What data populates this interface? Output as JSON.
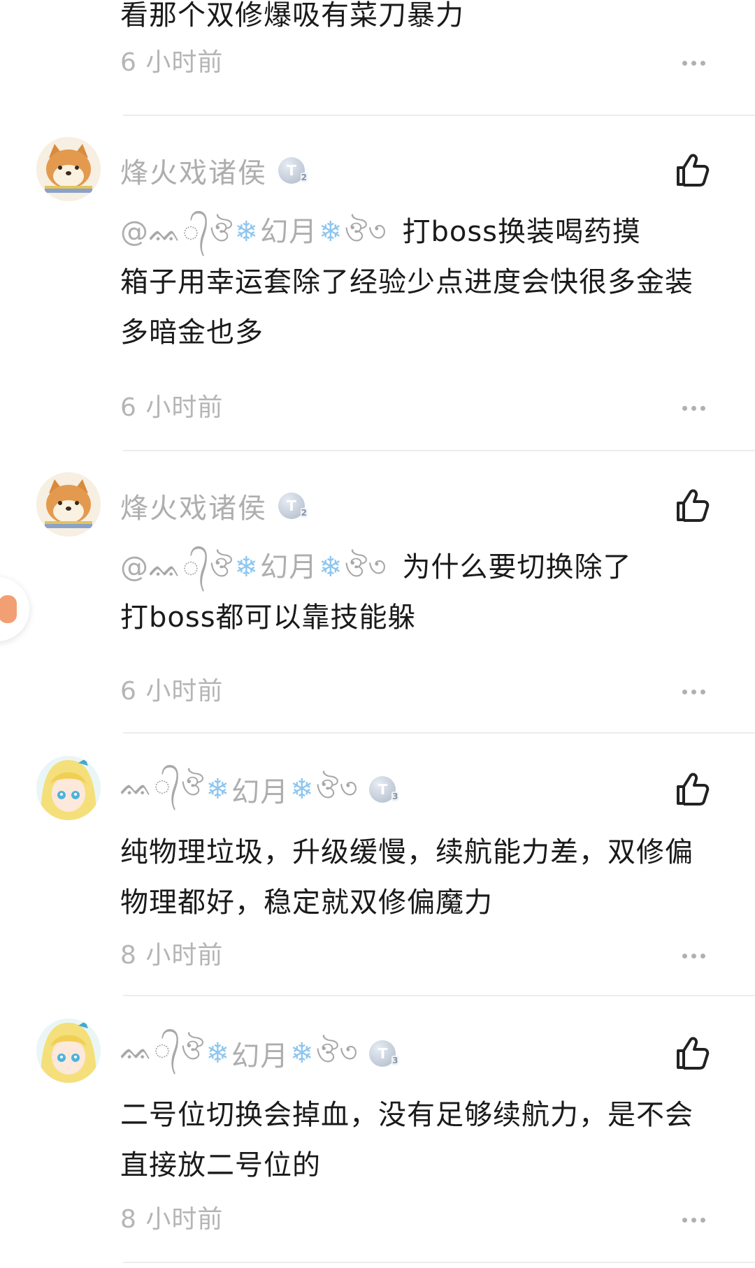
{
  "top_reply": {
    "text": "看那个双修爆吸有菜刀暴力",
    "time": "6 小时前"
  },
  "replies": [
    {
      "avatar": "shiba-dog-avatar",
      "name": "烽火戏诸侯",
      "badge": "T",
      "badge_level": "2",
      "mention_prefix": "@",
      "mention_swirl_left": "ᨐ᭄ঔ",
      "mention_core": "幻月",
      "mention_swirl_right": "ঔ৩",
      "text_first": "打boss换装喝药摸",
      "text_rest": "箱子用幸运套除了经验少点进度会快很多金装多暗金也多",
      "time": "6 小时前"
    },
    {
      "avatar": "shiba-dog-avatar",
      "name": "烽火戏诸侯",
      "badge": "T",
      "badge_level": "2",
      "mention_prefix": "@",
      "mention_swirl_left": "ᨐ᭄ঔ",
      "mention_core": "幻月",
      "mention_swirl_right": "ঔ৩",
      "text_first": "为什么要切换除了",
      "text_rest": "打boss都可以靠技能躲",
      "time": "6 小时前"
    },
    {
      "avatar": "anime-girl-avatar",
      "name_swirl_left": "ᨐ᭄ঔ",
      "name_core": "幻月",
      "name_swirl_right": "ঔ৩",
      "badge": "T",
      "badge_level": "3",
      "text": "纯物理垃圾，升级缓慢，续航能力差，双修偏物理都好，稳定就双修偏魔力",
      "time": "8 小时前"
    },
    {
      "avatar": "anime-girl-avatar",
      "name_swirl_left": "ᨐ᭄ঔ",
      "name_core": "幻月",
      "name_swirl_right": "ঔ৩",
      "badge": "T",
      "badge_level": "3",
      "text": "二号位切换会掉血，没有足够续航力，是不会直接放二号位的",
      "time": "8 小时前"
    }
  ],
  "icons": {
    "like": "thumbs-up-icon",
    "more": "more-dots-icon",
    "snowflake": "❄"
  },
  "colors": {
    "text": "#1a1a1a",
    "muted": "#aeaeae",
    "time": "#b5b5b5",
    "snowflake": "#8ec6ef",
    "divider": "#ececec"
  }
}
